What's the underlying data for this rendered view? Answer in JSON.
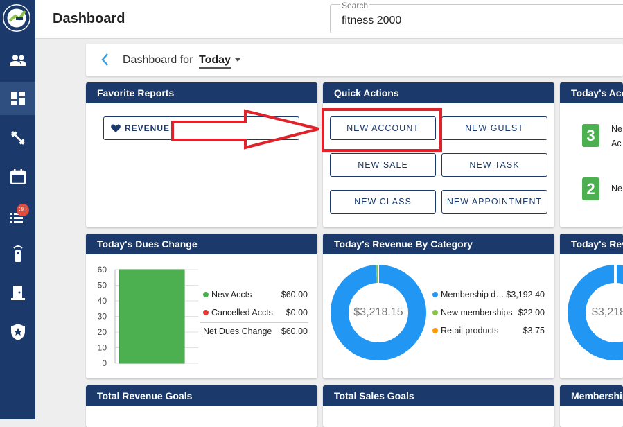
{
  "header": {
    "title": "Dashboard",
    "search": {
      "label": "Search",
      "value": "fitness 2000"
    }
  },
  "sidebar": {
    "notification_count": "30"
  },
  "subbar": {
    "prefix": "Dashboard for",
    "period": "Today"
  },
  "favorite_reports": {
    "title": "Favorite Reports",
    "button": "REVENUE"
  },
  "quick_actions": {
    "title": "Quick Actions",
    "buttons": [
      "NEW ACCOUNT",
      "NEW GUEST",
      "NEW SALE",
      "NEW TASK",
      "NEW CLASS",
      "NEW APPOINTMENT"
    ]
  },
  "todays_accounts": {
    "title": "Today's Acc",
    "items": [
      {
        "count": "3",
        "label": "Ne",
        "label2": "Ac"
      },
      {
        "count": "2",
        "label": "Ne"
      }
    ]
  },
  "dues_change": {
    "title": "Today's Dues Change",
    "legend": [
      {
        "label": "New Accts",
        "value": "$60.00",
        "color": "#4caf50"
      },
      {
        "label": "Cancelled Accts",
        "value": "$0.00",
        "color": "#e53935"
      }
    ],
    "net_label": "Net Dues Change",
    "net_value": "$60.00"
  },
  "revenue_by_category": {
    "title": "Today's Revenue By Category",
    "center_label": "$3,218.15",
    "legend": [
      {
        "label": "Membership d…",
        "value": "$3,192.40",
        "color": "#2196f3"
      },
      {
        "label": "New memberships",
        "value": "$22.00",
        "color": "#8bc34a"
      },
      {
        "label": "Retail products",
        "value": "$3.75",
        "color": "#ff9800"
      }
    ]
  },
  "todays_revenue": {
    "title": "Today's Reve",
    "center_label": "$3,218"
  },
  "bottom_cards": {
    "total_revenue_goals": "Total Revenue Goals",
    "total_sales_goals": "Total Sales Goals",
    "memberships": "Membership"
  },
  "chart_data": [
    {
      "type": "bar",
      "title": "Today's Dues Change",
      "categories": [
        "New Accts"
      ],
      "values": [
        60
      ],
      "ylim": [
        0,
        60
      ],
      "yticks": [
        "0",
        "10",
        "20",
        "30",
        "40",
        "50",
        "60"
      ],
      "grid": true
    },
    {
      "type": "pie",
      "title": "Today's Revenue By Category",
      "labels": [
        "Membership d…",
        "New memberships",
        "Retail products"
      ],
      "values": [
        3192.4,
        22.0,
        3.75
      ]
    }
  ],
  "colors": {
    "brand": "#1b3a6b",
    "annotation": "#e0232b"
  }
}
